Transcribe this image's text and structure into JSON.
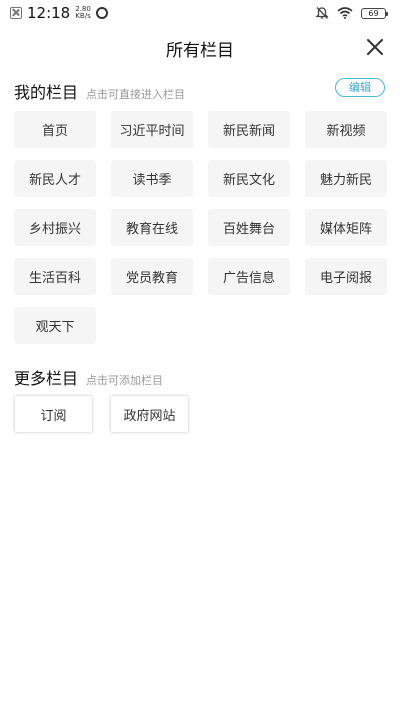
{
  "status_bar": {
    "time": "12:18",
    "speed_value": "2.80",
    "speed_unit": "KB/s",
    "battery": "69"
  },
  "header": {
    "title": "所有栏目"
  },
  "my_columns": {
    "title": "我的栏目",
    "hint": "点击可直接进入栏目",
    "edit_label": "编辑",
    "items": [
      "首页",
      "习近平时间",
      "新民新闻",
      "新视频",
      "新民人才",
      "读书季",
      "新民文化",
      "魅力新民",
      "乡村振兴",
      "教育在线",
      "百姓舞台",
      "媒体矩阵",
      "生活百科",
      "党员教育",
      "广告信息",
      "电子阅报",
      "观天下"
    ]
  },
  "more_columns": {
    "title": "更多栏目",
    "hint": "点击可添加栏目",
    "items": [
      "订阅",
      "政府网站"
    ]
  },
  "colors": {
    "accent": "#3aa8cc",
    "chip_bg": "#f5f5f5"
  }
}
